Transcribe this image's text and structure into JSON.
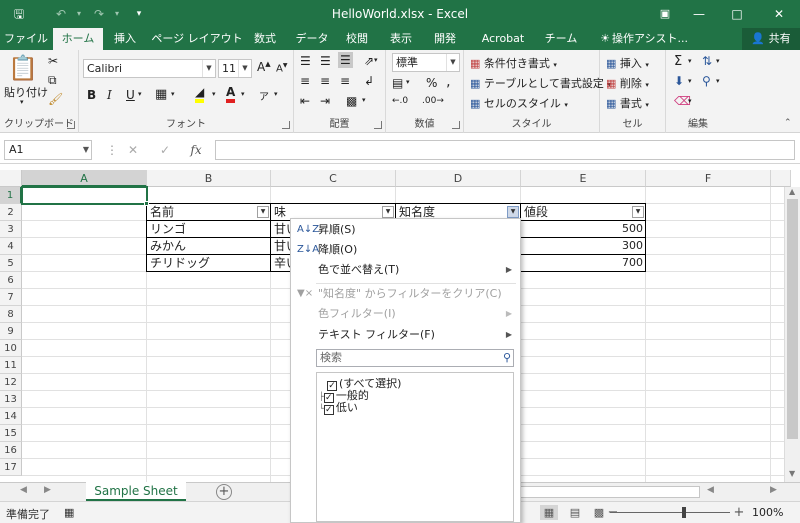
{
  "window": {
    "title": "HelloWorld.xlsx - Excel"
  },
  "ribbon_tabs": [
    "ファイル",
    "ホーム",
    "挿入",
    "ページ レイアウト",
    "数式",
    "データ",
    "校閲",
    "表示",
    "開発",
    "Acrobat",
    "チーム"
  ],
  "tell_me": "操作アシスト...",
  "share_label": "共有",
  "clipboard": {
    "paste_label": "貼り付け",
    "group_label": "クリップボード"
  },
  "font": {
    "name": "Calibri",
    "size": "11",
    "group_label": "フォント",
    "bold": "B",
    "italic": "I",
    "underline": "U",
    "grow": "A",
    "shrink": "A"
  },
  "alignment": {
    "group_label": "配置"
  },
  "number": {
    "format": "標準",
    "group_label": "数値"
  },
  "styles": {
    "conditional": "条件付き書式",
    "as_table": "テーブルとして書式設定",
    "cell_styles": "セルのスタイル",
    "group_label": "スタイル"
  },
  "cells": {
    "insert": "挿入",
    "delete": "削除",
    "format": "書式",
    "group_label": "セル"
  },
  "editing": {
    "group_label": "編集"
  },
  "formula_bar": {
    "name_box": "A1",
    "fx": "fx",
    "cancel": "✕",
    "enter": "✓"
  },
  "columns": [
    "A",
    "B",
    "C",
    "D",
    "E",
    "F"
  ],
  "rows": [
    "1",
    "2",
    "3",
    "4",
    "5",
    "6",
    "7",
    "8",
    "9",
    "10",
    "11",
    "12",
    "13",
    "14",
    "15",
    "16",
    "17"
  ],
  "table": {
    "headers": [
      "名前",
      "味",
      "知名度",
      "値段"
    ],
    "names": [
      "リンゴ",
      "みかん",
      "チリドッグ"
    ],
    "tastes": [
      "甘い",
      "甘い",
      "辛い"
    ],
    "prices": [
      "500",
      "300",
      "700"
    ]
  },
  "filter_menu": {
    "sort_asc": "昇順(S)",
    "sort_desc": "降順(O)",
    "sort_color": "色で並べ替え(T)",
    "clear_filter": "\"知名度\" からフィルターをクリア(C)",
    "color_filter": "色フィルター(I)",
    "text_filter": "テキスト フィルター(F)",
    "search_placeholder": "検索",
    "items": [
      "(すべて選択)",
      "一般的",
      "低い"
    ]
  },
  "sheets": {
    "active": "Sample Sheet"
  },
  "status": {
    "ready": "準備完了",
    "zoom": "100%"
  },
  "colors": {
    "excel_green": "#217346",
    "grid_line": "#e1e1e1",
    "menu_icon": "#2b579a"
  }
}
